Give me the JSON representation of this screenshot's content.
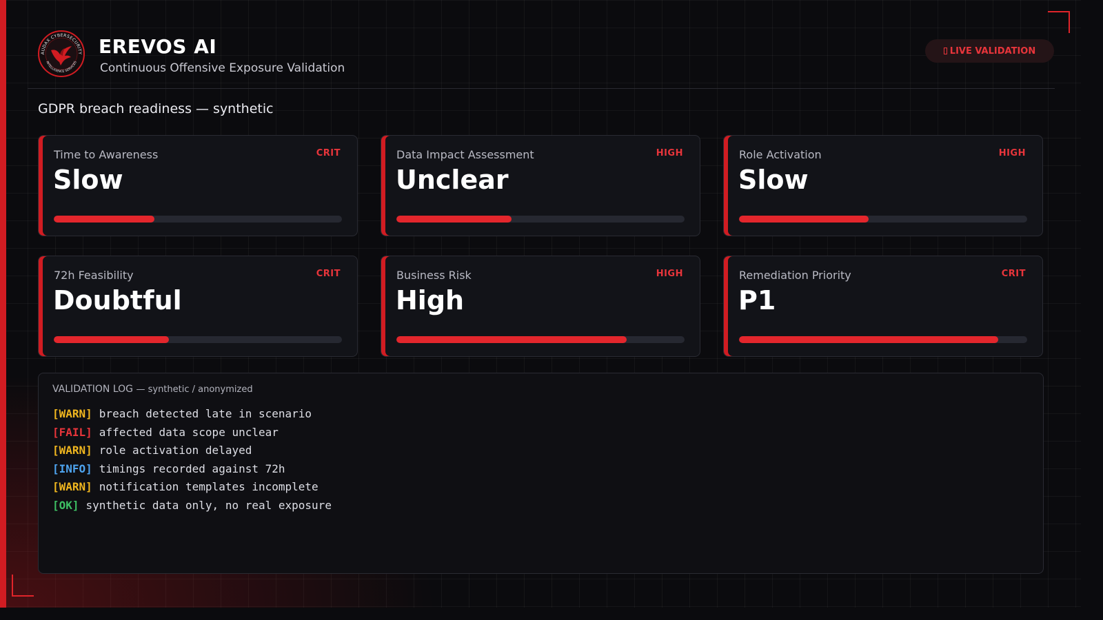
{
  "header": {
    "logo": {
      "ring_text_top": "AUDAX CYBERSECURITY",
      "ring_text_bottom": "INTELLIGENCE SERVICES",
      "icon": "phoenix-logo"
    },
    "title": "EREVOS AI",
    "subtitle": "Continuous Offensive Exposure Validation",
    "badge": {
      "icon": "signal-icon",
      "label": "LIVE VALIDATION"
    }
  },
  "section_title": "GDPR breach readiness — synthetic",
  "cards": [
    {
      "label": "Time to Awareness",
      "severity": "CRIT",
      "value": "Slow",
      "progress": 0.35
    },
    {
      "label": "Data Impact Assessment",
      "severity": "HIGH",
      "value": "Unclear",
      "progress": 0.4
    },
    {
      "label": "Role Activation",
      "severity": "HIGH",
      "value": "Slow",
      "progress": 0.45
    },
    {
      "label": "72h Feasibility",
      "severity": "CRIT",
      "value": "Doubtful",
      "progress": 0.4
    },
    {
      "label": "Business Risk",
      "severity": "HIGH",
      "value": "High",
      "progress": 0.8
    },
    {
      "label": "Remediation Priority",
      "severity": "CRIT",
      "value": "P1",
      "progress": 0.9
    }
  ],
  "log": {
    "title": "VALIDATION LOG",
    "subtitle": "— synthetic / anonymized",
    "lines": [
      {
        "tag": "[WARN]",
        "level": "warn",
        "text": "breach detected late in scenario"
      },
      {
        "tag": "[FAIL]",
        "level": "fail",
        "text": "affected data scope unclear"
      },
      {
        "tag": "[WARN]",
        "level": "warn",
        "text": "role activation delayed"
      },
      {
        "tag": "[INFO]",
        "level": "info",
        "text": "timings recorded against 72h"
      },
      {
        "tag": "[WARN]",
        "level": "warn",
        "text": "notification templates incomplete"
      },
      {
        "tag": "[OK]",
        "level": "ok",
        "text": "synthetic data only, no real exposure"
      }
    ]
  },
  "colors": {
    "accent": "#d11c22",
    "warn": "#f0b61f",
    "fail": "#e8353b",
    "info": "#4ea4f0",
    "ok": "#3dbf63",
    "background": "#0b0b0e"
  }
}
